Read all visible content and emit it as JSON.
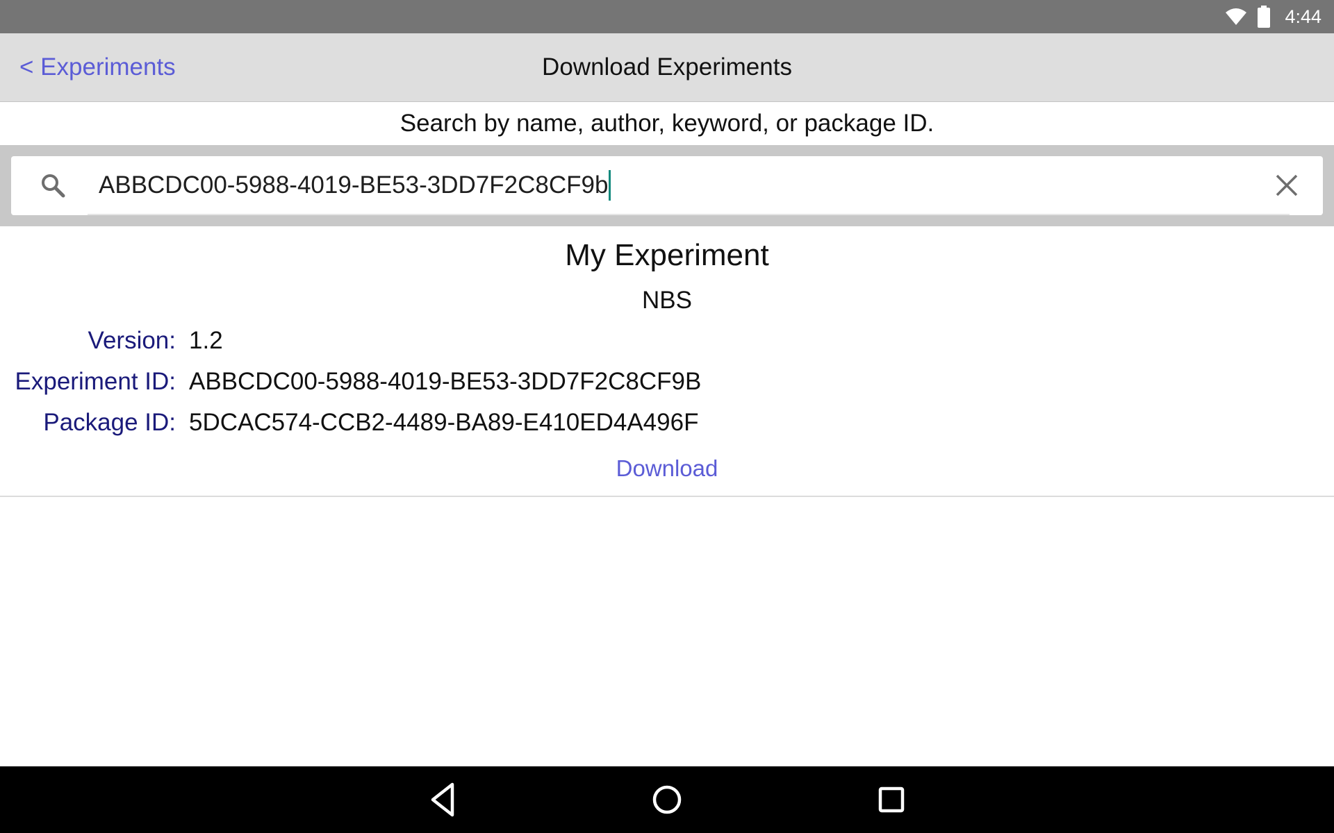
{
  "status_bar": {
    "time": "4:44",
    "icons": [
      "wifi-icon",
      "battery-icon"
    ]
  },
  "nav": {
    "back_label": "< Experiments",
    "title": "Download Experiments"
  },
  "search": {
    "hint": "Search by name, author, keyword, or package ID.",
    "value": "ABBCDC00-5988-4019-BE53-3DD7F2C8CF9b",
    "icon": "search-icon",
    "clear_icon": "close-icon"
  },
  "result": {
    "title": "My Experiment",
    "author": "NBS",
    "fields": [
      {
        "label": "Version:",
        "value": "1.2"
      },
      {
        "label": "Experiment ID:",
        "value": "ABBCDC00-5988-4019-BE53-3DD7F2C8CF9B"
      },
      {
        "label": "Package ID:",
        "value": "5DCAC574-CCB2-4489-BA89-E410ED4A496F"
      }
    ],
    "download_label": "Download"
  },
  "system_nav": {
    "buttons": [
      "back-icon",
      "home-icon",
      "recents-icon"
    ]
  },
  "colors": {
    "accent": "#5b5cd6",
    "label": "#1a1a7a",
    "status_bar": "#757575",
    "nav_bar": "#dedede",
    "cursor": "#13897d"
  }
}
